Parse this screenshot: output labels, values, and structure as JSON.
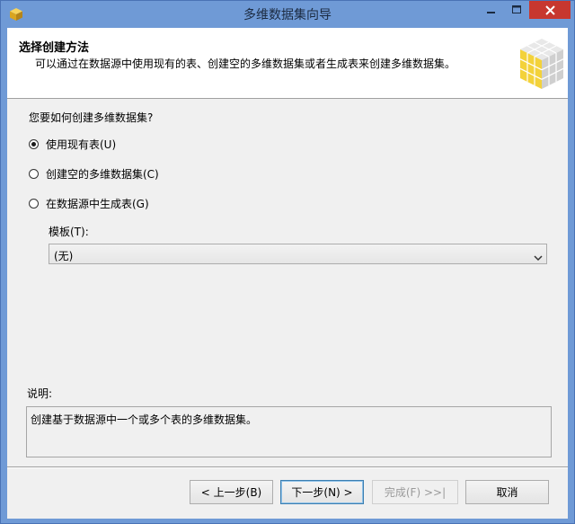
{
  "window": {
    "title": "多维数据集向导"
  },
  "header": {
    "title": "选择创建方法",
    "subtitle": "可以通过在数据源中使用现有的表、创建空的多维数据集或者生成表来创建多维数据集。"
  },
  "main": {
    "question": "您要如何创建多维数据集?",
    "options": [
      {
        "label": "使用现有表(U)",
        "checked": true
      },
      {
        "label": "创建空的多维数据集(C)",
        "checked": false
      },
      {
        "label": "在数据源中生成表(G)",
        "checked": false
      }
    ],
    "template_label": "模板(T):",
    "template_value": "(无)",
    "description_label": "说明:",
    "description_text": "创建基于数据源中一个或多个表的多维数据集。"
  },
  "footer": {
    "back": "< 上一步(B)",
    "next": "下一步(N) >",
    "finish": "完成(F) >>|",
    "cancel": "取消"
  },
  "colors": {
    "titlebar": "#6f9ad6",
    "close_button": "#c7372f",
    "dialog_bg": "#f0f0f0",
    "default_button_border": "#3c7fb1"
  }
}
